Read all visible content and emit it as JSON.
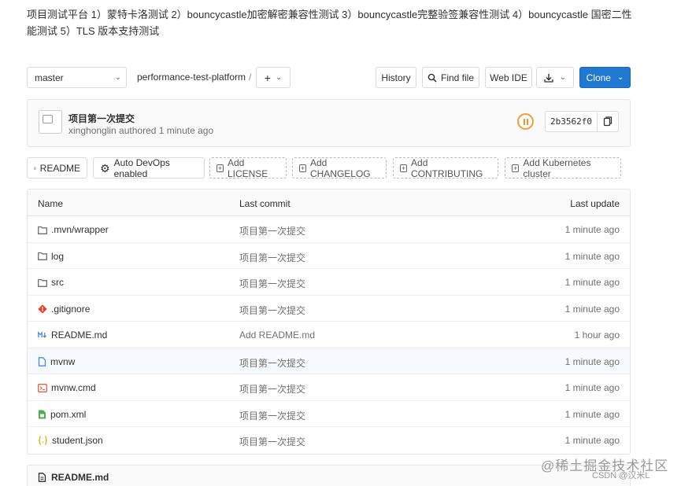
{
  "intro": "项目测试平台 1）蒙特卡洛测试 2）bouncycastle加密解密兼容性测试 3）bouncycastle完整验签兼容性测试 4）bouncycastle 国密二性能测试 5）TLS 版本支持测试",
  "toolbar": {
    "branch": "master",
    "path": "performance-test-platform",
    "separator": "/",
    "plus": "+",
    "history": "History",
    "find_file": "Find file",
    "web_ide": "Web IDE",
    "clone": "Clone"
  },
  "commit": {
    "title": "项目第一次提交",
    "meta": "xinghonglin authored 1 minute ago",
    "sha": "2b3562f0"
  },
  "badges": [
    {
      "label": "README",
      "icon": "file-icon"
    },
    {
      "label": "Auto DevOps enabled",
      "icon": "gear-icon"
    },
    {
      "label": "Add LICENSE",
      "icon": "plus-square-icon"
    },
    {
      "label": "Add CHANGELOG",
      "icon": "plus-square-icon"
    },
    {
      "label": "Add CONTRIBUTING",
      "icon": "plus-square-icon"
    },
    {
      "label": "Add Kubernetes cluster",
      "icon": "plus-square-icon"
    }
  ],
  "table": {
    "headers": {
      "name": "Name",
      "last_commit": "Last commit",
      "last_update": "Last update"
    },
    "rows": [
      {
        "name": ".mvn/wrapper",
        "icon": "folder-icon",
        "commit": "项目第一次提交",
        "updated": "1 minute ago"
      },
      {
        "name": "log",
        "icon": "folder-icon",
        "commit": "项目第一次提交",
        "updated": "1 minute ago"
      },
      {
        "name": "src",
        "icon": "folder-icon",
        "commit": "项目第一次提交",
        "updated": "1 minute ago"
      },
      {
        "name": ".gitignore",
        "icon": "git-icon",
        "commit": "项目第一次提交",
        "updated": "1 minute ago"
      },
      {
        "name": "README.md",
        "icon": "markdown-icon",
        "commit": "Add README.md",
        "updated": "1 hour ago"
      },
      {
        "name": "mvnw",
        "icon": "file-icon",
        "commit": "项目第一次提交",
        "updated": "1 minute ago"
      },
      {
        "name": "mvnw.cmd",
        "icon": "terminal-icon",
        "commit": "项目第一次提交",
        "updated": "1 minute ago"
      },
      {
        "name": "pom.xml",
        "icon": "xml-file-icon",
        "commit": "项目第一次提交",
        "updated": "1 minute ago"
      },
      {
        "name": "student.json",
        "icon": "json-icon",
        "commit": "项目第一次提交",
        "updated": "1 minute ago"
      }
    ]
  },
  "readme": {
    "title": "README.md"
  },
  "watermark": {
    "line1": "@稀土掘金技术社区",
    "line2": "CSDN @汉米L"
  },
  "colors": {
    "primary": "#1f78d1",
    "pipeline": "#f0a030",
    "folder": "#707070",
    "git": "#e24329",
    "markdown": "#4b8bd8",
    "terminal": "#e0634a",
    "xml": "#4caf50",
    "json": "#e6b800"
  }
}
